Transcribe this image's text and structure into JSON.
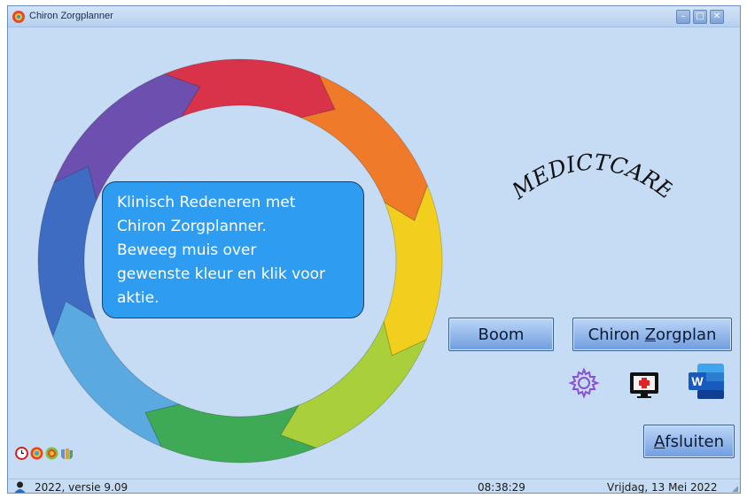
{
  "window": {
    "title": "Chiron Zorgplanner",
    "minimize_symbol": "–",
    "maximize_symbol": "□",
    "close_symbol": "✕"
  },
  "info_bubble": {
    "lines": [
      "Klinisch Redeneren met",
      "Chiron Zorgplanner.",
      "Beweeg muis over",
      "gewenste kleur en klik voor",
      "aktie."
    ]
  },
  "logo": {
    "text": "MEDICTCARE"
  },
  "buttons": {
    "boom": "Boom",
    "zorgplan_prefix": "Chiron ",
    "zorgplan_underlined": "Z",
    "zorgplan_suffix": "orgplan",
    "afsluiten_underlined": "A",
    "afsluiten_suffix": "fsluiten"
  },
  "tools": {
    "settings_icon": "gear-icon",
    "monitor_icon": "medical-monitor-icon",
    "word_icon": "word-icon",
    "word_letter": "W"
  },
  "statusbar": {
    "version": "2022, versie 9.09",
    "time": "08:38:29",
    "date": "Vrijdag, 13 Mei 2022"
  },
  "colors": {
    "window_bg": "#c6dcf4",
    "bubble_bg": "#2e9cf0",
    "ring_segments": [
      "#d9334a",
      "#ef7a2a",
      "#f2cf1d",
      "#a9cf3a",
      "#3faa55",
      "#5aa9e0",
      "#3e6cc2",
      "#6d4fb0"
    ]
  }
}
